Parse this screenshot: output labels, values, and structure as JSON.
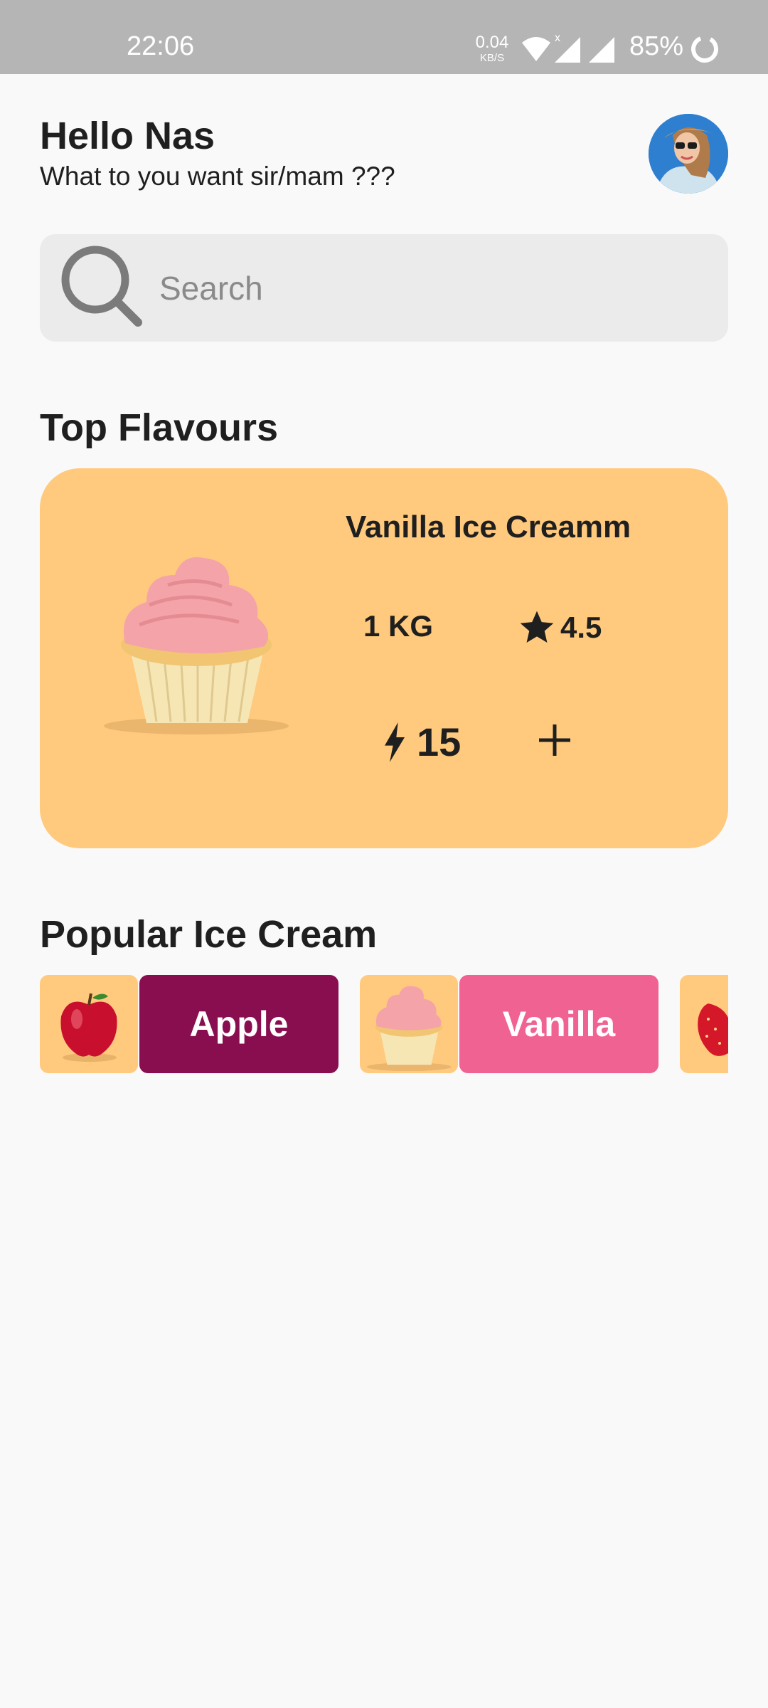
{
  "status_bar": {
    "time": "22:06",
    "net_speed_value": "0.04",
    "net_speed_unit": "KB/S",
    "battery": "85%"
  },
  "header": {
    "greeting": "Hello Nas",
    "subtitle": "What to you want sir/mam ???"
  },
  "search": {
    "placeholder": "Search"
  },
  "top_flavours": {
    "title": "Top Flavours",
    "card": {
      "name": "Vanilla Ice Creamm",
      "weight": "1 KG",
      "rating": "4.5",
      "energy": "15"
    }
  },
  "popular": {
    "title": "Popular Ice Cream",
    "items": [
      {
        "label": "Apple",
        "image": "apple",
        "color": "#880e4f"
      },
      {
        "label": "Vanilla",
        "image": "cupcake",
        "color": "#f06292"
      },
      {
        "label": "",
        "image": "strawberry",
        "color": "#ffca7e"
      }
    ]
  },
  "colors": {
    "accent_card": "#ffca7e",
    "apple_button": "#880e4f",
    "vanilla_button": "#f06292",
    "status_bar": "#b5b5b5"
  }
}
